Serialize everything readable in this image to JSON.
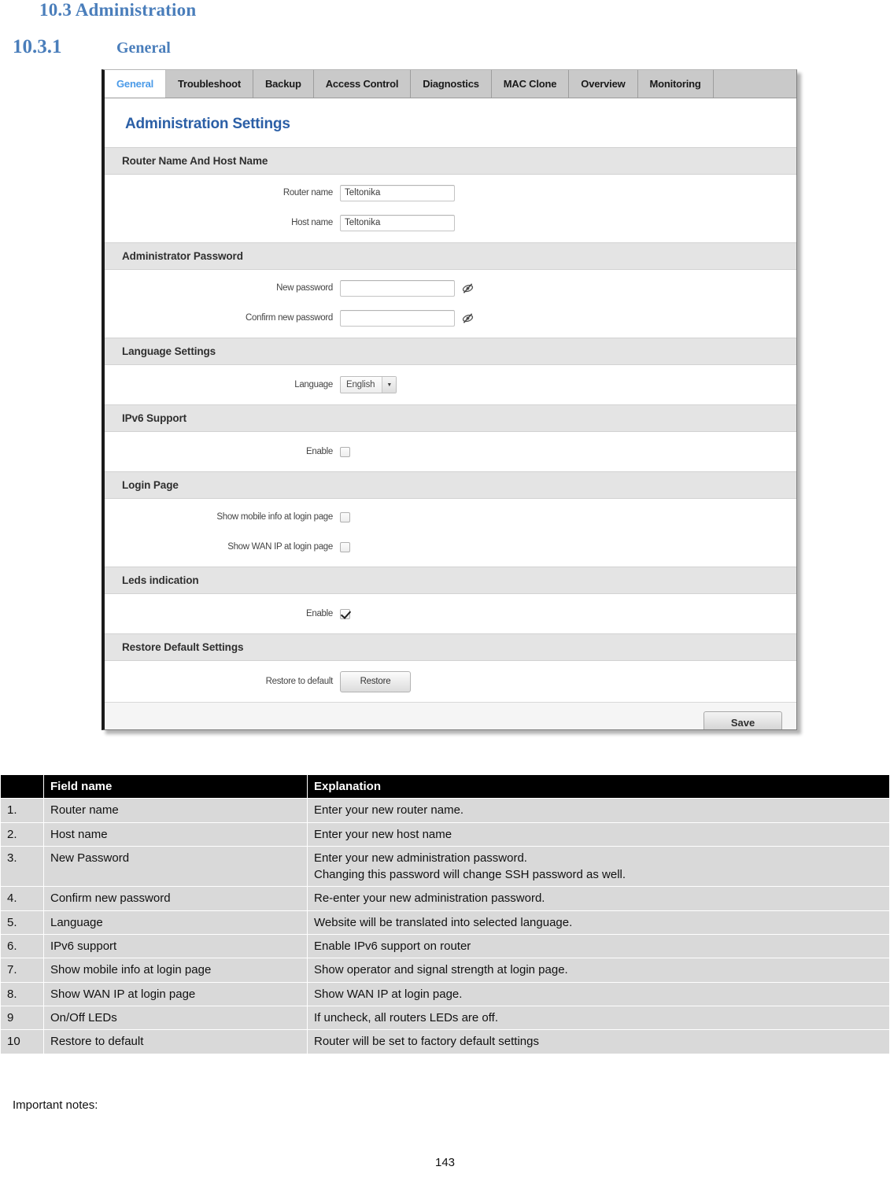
{
  "document": {
    "heading_section": "10.3 Administration",
    "subheading_number": "10.3.1",
    "subheading_text": "General",
    "important_notes_label": "Important notes:",
    "page_number": "143"
  },
  "router_ui": {
    "tabs": [
      {
        "label": "General",
        "active": true
      },
      {
        "label": "Troubleshoot",
        "active": false
      },
      {
        "label": "Backup",
        "active": false
      },
      {
        "label": "Access Control",
        "active": false
      },
      {
        "label": "Diagnostics",
        "active": false
      },
      {
        "label": "MAC Clone",
        "active": false
      },
      {
        "label": "Overview",
        "active": false
      },
      {
        "label": "Monitoring",
        "active": false
      }
    ],
    "panel_title": "Administration Settings",
    "sections": {
      "router_host": {
        "title": "Router Name And Host Name",
        "router_name_label": "Router name",
        "router_name_value": "Teltonika",
        "host_name_label": "Host name",
        "host_name_value": "Teltonika"
      },
      "admin_password": {
        "title": "Administrator Password",
        "new_password_label": "New password",
        "new_password_value": "",
        "confirm_password_label": "Confirm new password",
        "confirm_password_value": ""
      },
      "language": {
        "title": "Language Settings",
        "label": "Language",
        "selected": "English"
      },
      "ipv6": {
        "title": "IPv6 Support",
        "enable_label": "Enable",
        "enable_checked": false
      },
      "login_page": {
        "title": "Login Page",
        "show_mobile_info_label": "Show mobile info at login page",
        "show_mobile_info_checked": false,
        "show_wan_ip_label": "Show WAN IP at login page",
        "show_wan_ip_checked": false
      },
      "leds": {
        "title": "Leds indication",
        "enable_label": "Enable",
        "enable_checked": true
      },
      "restore": {
        "title": "Restore Default Settings",
        "label": "Restore to default",
        "button_label": "Restore"
      }
    },
    "save_button_label": "Save",
    "colors": {
      "active_tab_text": "#4a9ae8",
      "panel_title": "#2b5fa6",
      "tab_background": "#c9c9c9",
      "section_header_background": "#e4e4e4"
    }
  },
  "explanation_table": {
    "headers": [
      "",
      "Field name",
      "Explanation"
    ],
    "rows": [
      {
        "index": "1.",
        "field": "Router name",
        "explanation": "Enter your new router name."
      },
      {
        "index": "2.",
        "field": "Host name",
        "explanation": "Enter your new host name"
      },
      {
        "index": "3.",
        "field": "New Password",
        "explanation": "Enter your new administration password.\nChanging this password will change SSH password as well."
      },
      {
        "index": "4.",
        "field": "Confirm new password",
        "explanation": "Re-enter your new administration password."
      },
      {
        "index": "5.",
        "field": "Language",
        "explanation": "Website will be translated into selected language."
      },
      {
        "index": "6.",
        "field": "IPv6 support",
        "explanation": "Enable IPv6 support on router"
      },
      {
        "index": "7.",
        "field": "Show mobile info at login page",
        "explanation": "Show operator and signal strength at login page."
      },
      {
        "index": "8.",
        "field": "Show WAN IP at login page",
        "explanation": "Show WAN IP at login page."
      },
      {
        "index": "9",
        "field": "On/Off  LEDs",
        "explanation": "If uncheck, all routers LEDs are off."
      },
      {
        "index": "10",
        "field": "Restore to default",
        "explanation": "Router will be set to factory default settings"
      }
    ]
  }
}
